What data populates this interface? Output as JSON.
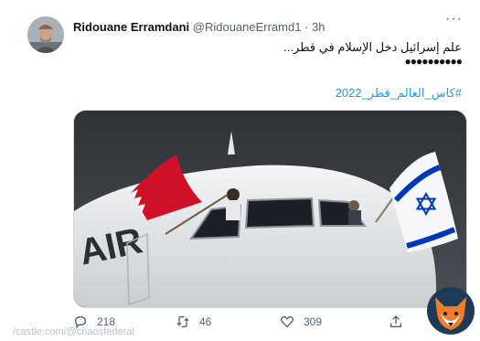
{
  "tweet": {
    "author_name": "Ridouane Erramdani",
    "handle": "@RidouaneErramd1",
    "separator": "·",
    "time": "3h",
    "text_line1": "علم إسرائيل دخل الإسلام في قطر...",
    "text_line2": "●●●●●●●●●●",
    "hashtag": "#كاس_العالم_قطر_2022",
    "more_label": "···"
  },
  "media": {
    "image_alt": "Airplane with Bahrain and Israel flags waved from cockpit windows"
  },
  "actions": {
    "reply_count": "218",
    "retweet_count": "46",
    "like_count": "309"
  },
  "watermark": "/castle.com/@chaosfederal",
  "icons": [
    "reply-icon",
    "retweet-icon",
    "like-icon",
    "share-icon",
    "fox-logo-icon"
  ],
  "colors": {
    "link": "#1d9bf0",
    "muted": "#536471",
    "bahrain_red": "#ce1126",
    "israel_blue": "#0038b8"
  }
}
